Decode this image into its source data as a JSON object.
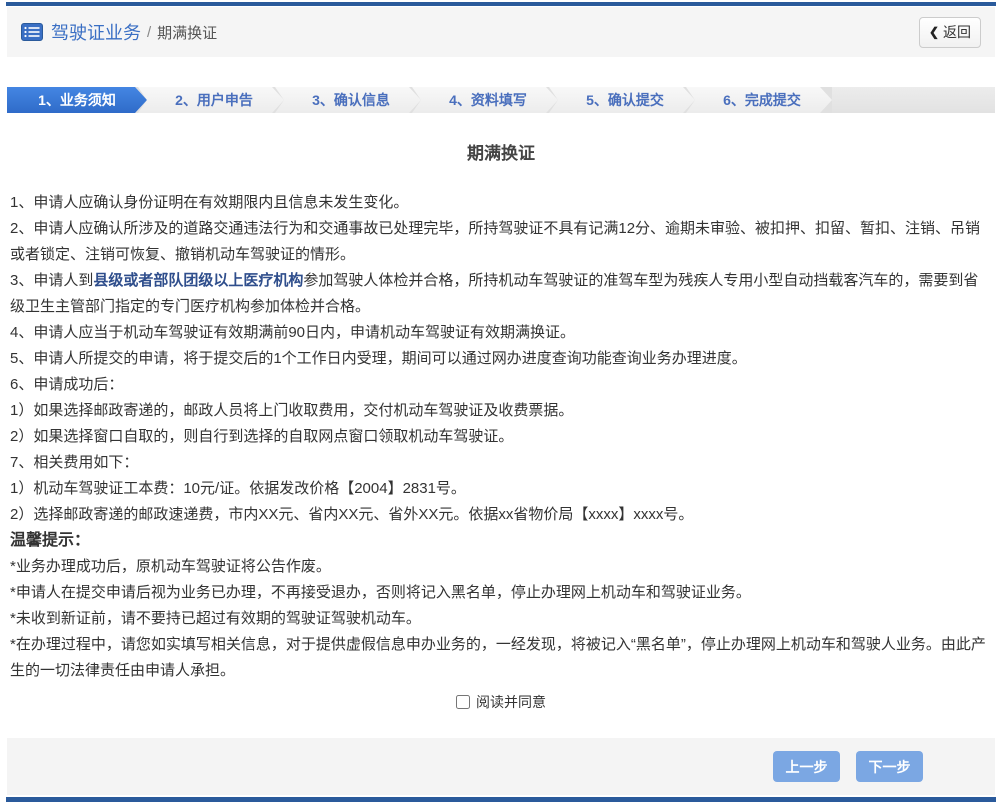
{
  "header": {
    "title": "驾驶证业务",
    "separator": "/",
    "subtitle": "期满换证",
    "back_chevron": "❮",
    "back_label": "返回"
  },
  "steps": [
    {
      "label": "1、业务须知",
      "active": true
    },
    {
      "label": "2、用户申告",
      "active": false
    },
    {
      "label": "3、确认信息",
      "active": false
    },
    {
      "label": "4、资料填写",
      "active": false
    },
    {
      "label": "5、确认提交",
      "active": false
    },
    {
      "label": "6、完成提交",
      "active": false
    }
  ],
  "main": {
    "title": "期满换证",
    "notices": [
      {
        "parts": [
          {
            "text": "1、申请人应确认身份证明在有效期限内且信息未发生变化。",
            "bold": false
          }
        ]
      },
      {
        "parts": [
          {
            "text": "2、申请人应确认所涉及的道路交通违法行为和交通事故已处理完毕，所持驾驶证不具有记满12分、逾期未审验、被扣押、扣留、暂扣、注销、吊销或者锁定、注销可恢复、撤销机动车驾驶证的情形。",
            "bold": false
          }
        ]
      },
      {
        "parts": [
          {
            "text": "3、申请人到",
            "bold": false
          },
          {
            "text": "县级或者部队团级以上医疗机构",
            "bold": true
          },
          {
            "text": "参加驾驶人体检并合格，所持机动车驾驶证的准驾车型为残疾人专用小型自动挡载客汽车的，需要到省级卫生主管部门指定的专门医疗机构参加体检并合格。",
            "bold": false
          }
        ]
      },
      {
        "parts": [
          {
            "text": "4、申请人应当于机动车驾驶证有效期满前90日内，申请机动车驾驶证有效期满换证。",
            "bold": false
          }
        ]
      },
      {
        "parts": [
          {
            "text": "5、申请人所提交的申请，将于提交后的1个工作日内受理，期间可以通过网办进度查询功能查询业务办理进度。",
            "bold": false
          }
        ]
      },
      {
        "parts": [
          {
            "text": "6、申请成功后：",
            "bold": false
          }
        ]
      },
      {
        "parts": [
          {
            "text": "1）如果选择邮政寄递的，邮政人员将上门收取费用，交付机动车驾驶证及收费票据。",
            "bold": false
          }
        ]
      },
      {
        "parts": [
          {
            "text": "2）如果选择窗口自取的，则自行到选择的自取网点窗口领取机动车驾驶证。",
            "bold": false
          }
        ]
      },
      {
        "parts": [
          {
            "text": "7、相关费用如下：",
            "bold": false
          }
        ]
      },
      {
        "parts": [
          {
            "text": "1）机动车驾驶证工本费：10元/证。依据发改价格【2004】2831号。",
            "bold": false
          }
        ]
      },
      {
        "parts": [
          {
            "text": "2）选择邮政寄递的邮政速递费，市内XX元、省内XX元、省外XX元。依据xx省物价局【xxxx】xxxx号。",
            "bold": false
          }
        ]
      }
    ],
    "tips_title": "温馨提示：",
    "tips": [
      "*业务办理成功后，原机动车驾驶证将公告作废。",
      "*申请人在提交申请后视为业务已办理，不再接受退办，否则将记入黑名单，停止办理网上机动车和驾驶证业务。",
      "*未收到新证前，请不要持已超过有效期的驾驶证驾驶机动车。",
      "*在办理过程中，请您如实填写相关信息，对于提供虚假信息申办业务的，一经发现，将被记入“黑名单”，停止办理网上机动车和驾驶人业务。由此产生的一切法律责任由申请人承担。"
    ],
    "agree_label": "阅读并同意"
  },
  "footer": {
    "prev_label": "上一步",
    "next_label": "下一步"
  },
  "colors": {
    "accent_bar": "#2a5a9b",
    "active_step": "#3d7bd5",
    "step_text": "#4a6fbd",
    "header_title": "#3a6fc4",
    "nav_button": "#7ba7e3",
    "bold_text": "#2f4e8c",
    "panel_gray": "#f4f4f4"
  }
}
